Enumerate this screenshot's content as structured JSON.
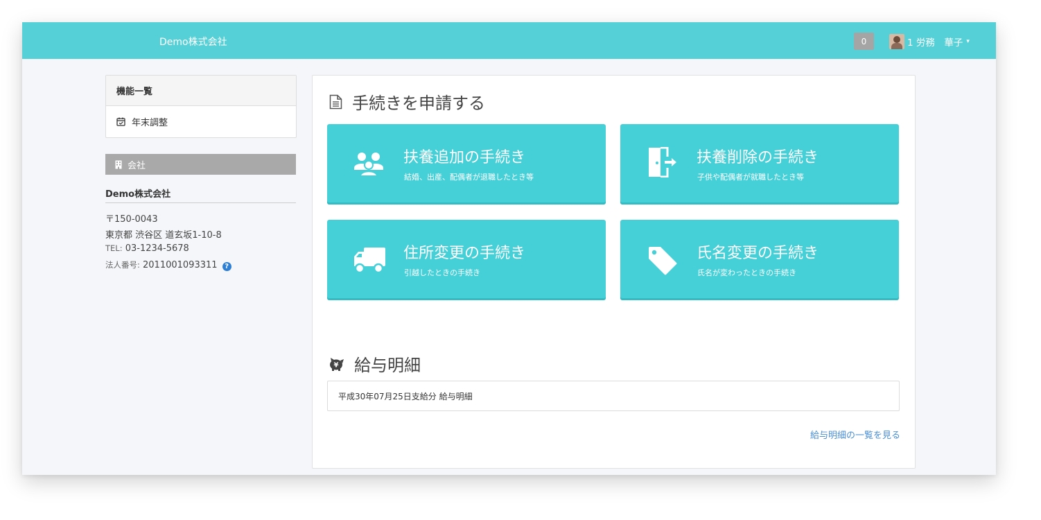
{
  "navbar": {
    "brand": "Demo株式会社",
    "notification_count": "0",
    "user_name": "1 労務　華子",
    "caret": "▾"
  },
  "sidebar": {
    "menu_title": "機能一覧",
    "menu_items": [
      {
        "label": "年末調整",
        "icon": "calendar-check-icon"
      }
    ],
    "company_section_label": "会社",
    "company_name": "Demo株式会社",
    "postal": "〒150-0043",
    "address": "東京都 渋谷区 道玄坂1-10-8",
    "tel_label": "TEL:",
    "tel": "03-1234-5678",
    "corp_number_label": "法人番号:",
    "corp_number": "2011001093311",
    "help_glyph": "?"
  },
  "procedures": {
    "title": "手続きを申請する",
    "tiles": [
      {
        "title": "扶養追加の手続き",
        "subtitle": "結婚、出産、配偶者が退職したとき等",
        "icon": "users-icon"
      },
      {
        "title": "扶養削除の手続き",
        "subtitle": "子供や配偶者が就職したとき等",
        "icon": "door-exit-icon"
      },
      {
        "title": "住所変更の手続き",
        "subtitle": "引越したときの手続き",
        "icon": "truck-icon"
      },
      {
        "title": "氏名変更の手続き",
        "subtitle": "氏名が変わったときの手続き",
        "icon": "tag-icon"
      }
    ]
  },
  "payslips": {
    "title": "給与明細",
    "items": [
      "平成30年07月25日支給分 給与明細"
    ],
    "view_all": "給与明細の一覧を見る"
  },
  "colors": {
    "navbar": "#55d0d6",
    "tile": "#45d0d8",
    "company_bar": "#a9a9a9",
    "link": "#4a8fd4"
  }
}
